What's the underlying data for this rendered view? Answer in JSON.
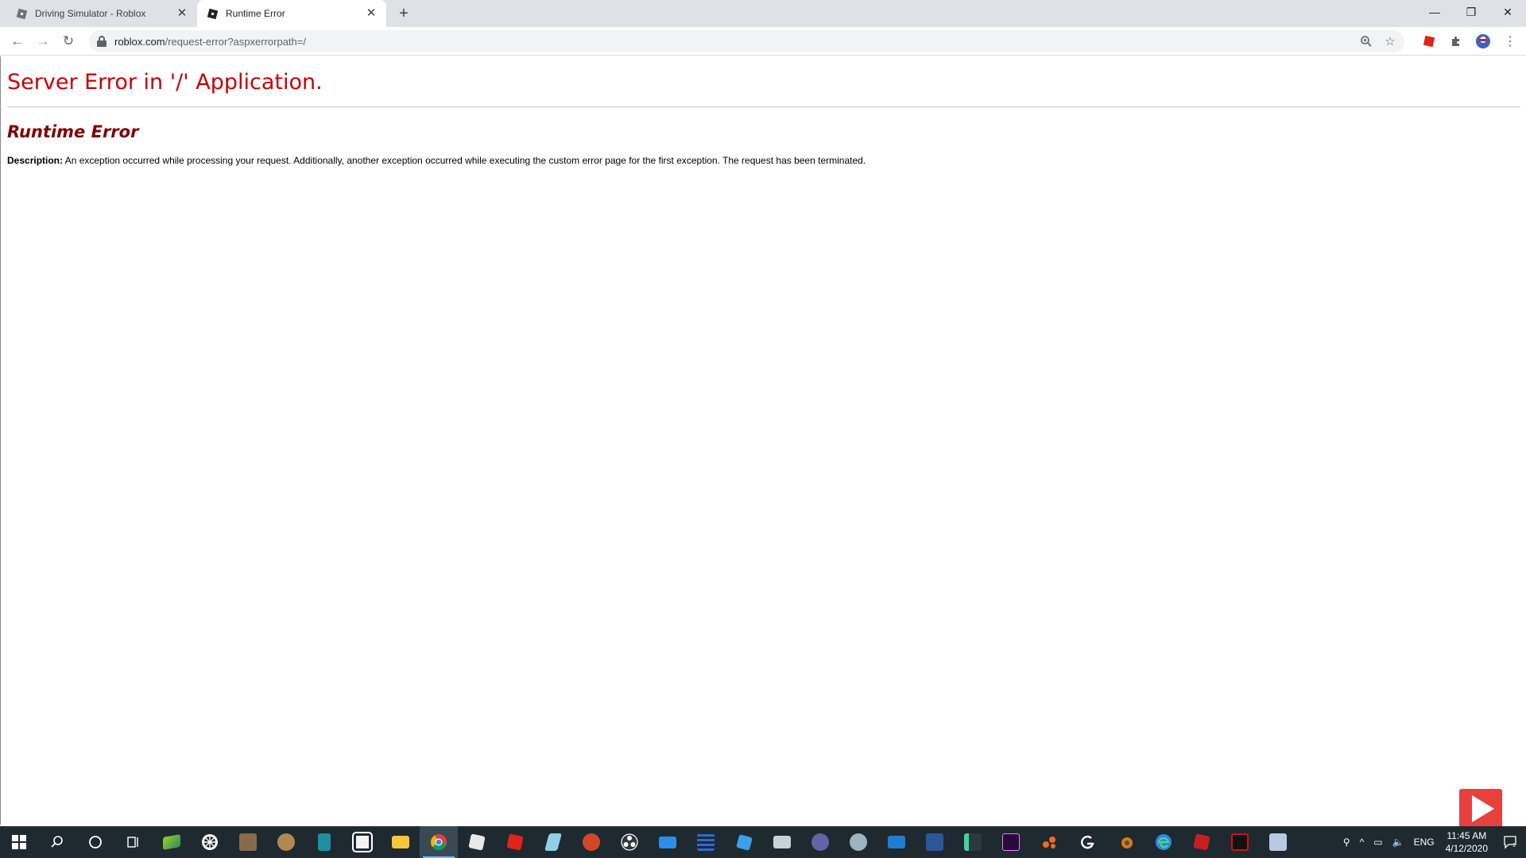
{
  "browser": {
    "tabs": [
      {
        "title": "Driving Simulator - Roblox",
        "active": false
      },
      {
        "title": "Runtime Error",
        "active": true
      }
    ],
    "new_tab": "+",
    "url_host": "roblox.com",
    "url_path": "/request-error?aspxerrorpath=/"
  },
  "page": {
    "title": "Server Error in '/' Application.",
    "subtitle": "Runtime Error",
    "description_label": "Description:",
    "description_text": "An exception occurred while processing your request. Additionally, another exception occurred while executing the custom error page for the first exception. The request has been terminated."
  },
  "taskbar": {
    "language": "ENG",
    "time": "11:45 AM",
    "date": "4/12/2020",
    "notifications": "1"
  },
  "colors": {
    "error_title": "#c80000",
    "error_subtitle": "#800000",
    "taskbar_bg": "#1f2a30"
  }
}
